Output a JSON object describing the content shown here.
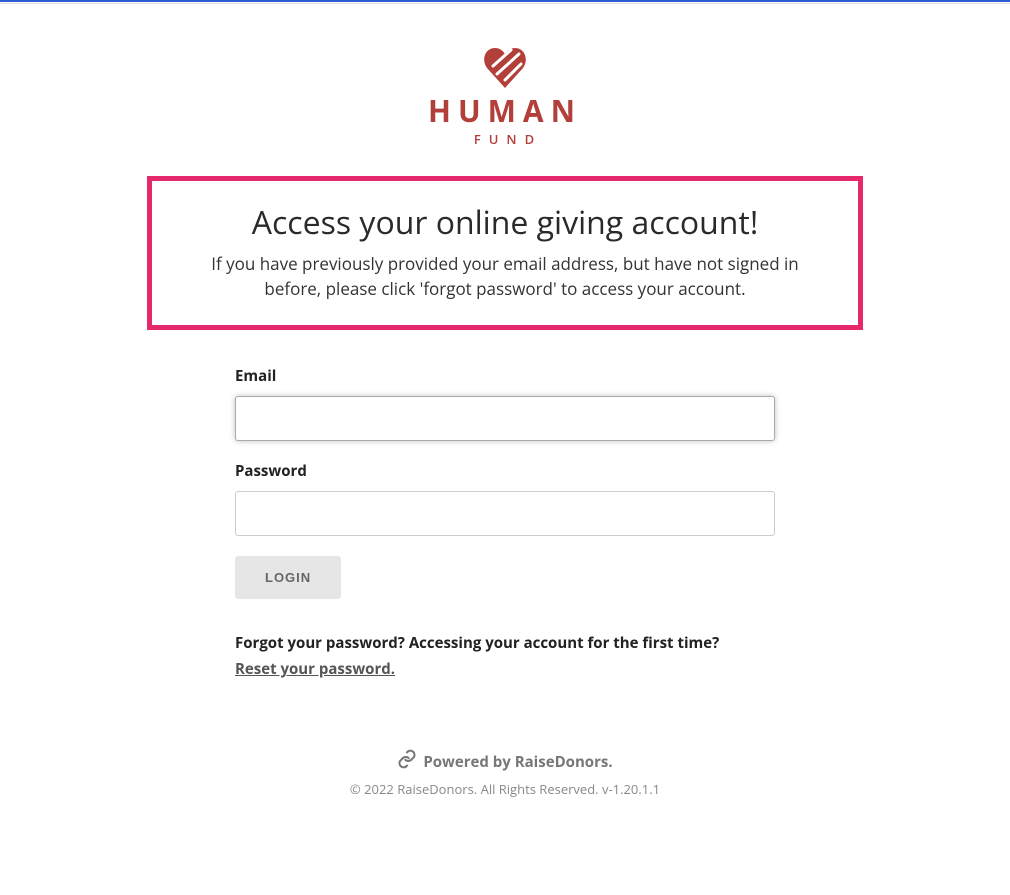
{
  "logo": {
    "title": "HUMAN",
    "subtitle": "FUND"
  },
  "banner": {
    "title": "Access your online giving account!",
    "description": "If you have previously provided your email address, but have not signed in before, please click 'forgot password' to access your account."
  },
  "form": {
    "email_label": "Email",
    "email_value": "",
    "password_label": "Password",
    "password_value": "",
    "login_button": "LOGIN",
    "help_text": "Forgot your password? Accessing your account for the first time?",
    "reset_link": "Reset your password."
  },
  "footer": {
    "powered": "Powered by RaiseDonors.",
    "copyright": "© 2022 RaiseDonors. All Rights Reserved. v-1.20.1.1"
  }
}
